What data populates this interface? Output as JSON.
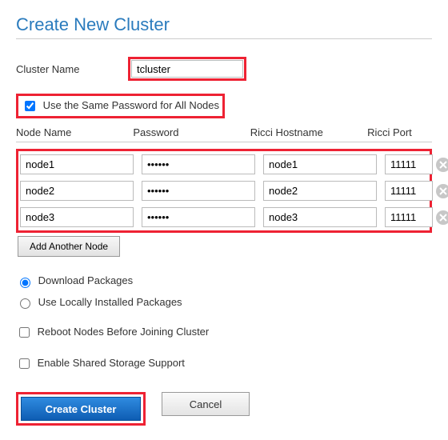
{
  "title": "Create New Cluster",
  "cluster_name_label": "Cluster Name",
  "cluster_name_value": "tcluster",
  "same_password_label": "Use the Same Password for All Nodes",
  "same_password_checked": true,
  "columns": {
    "node": "Node Name",
    "pass": "Password",
    "host": "Ricci Hostname",
    "port": "Ricci Port"
  },
  "nodes": [
    {
      "name": "node1",
      "password": "••••••",
      "hostname": "node1",
      "port": "11111"
    },
    {
      "name": "node2",
      "password": "••••••",
      "hostname": "node2",
      "port": "11111"
    },
    {
      "name": "node3",
      "password": "••••••",
      "hostname": "node3",
      "port": "11111"
    }
  ],
  "add_node_label": "Add Another Node",
  "package_mode": "download",
  "opts": {
    "download": "Download Packages",
    "local": "Use Locally Installed Packages",
    "reboot": "Reboot Nodes Before Joining Cluster",
    "shared": "Enable Shared Storage Support"
  },
  "reboot_checked": false,
  "shared_checked": false,
  "buttons": {
    "create": "Create Cluster",
    "cancel": "Cancel"
  }
}
